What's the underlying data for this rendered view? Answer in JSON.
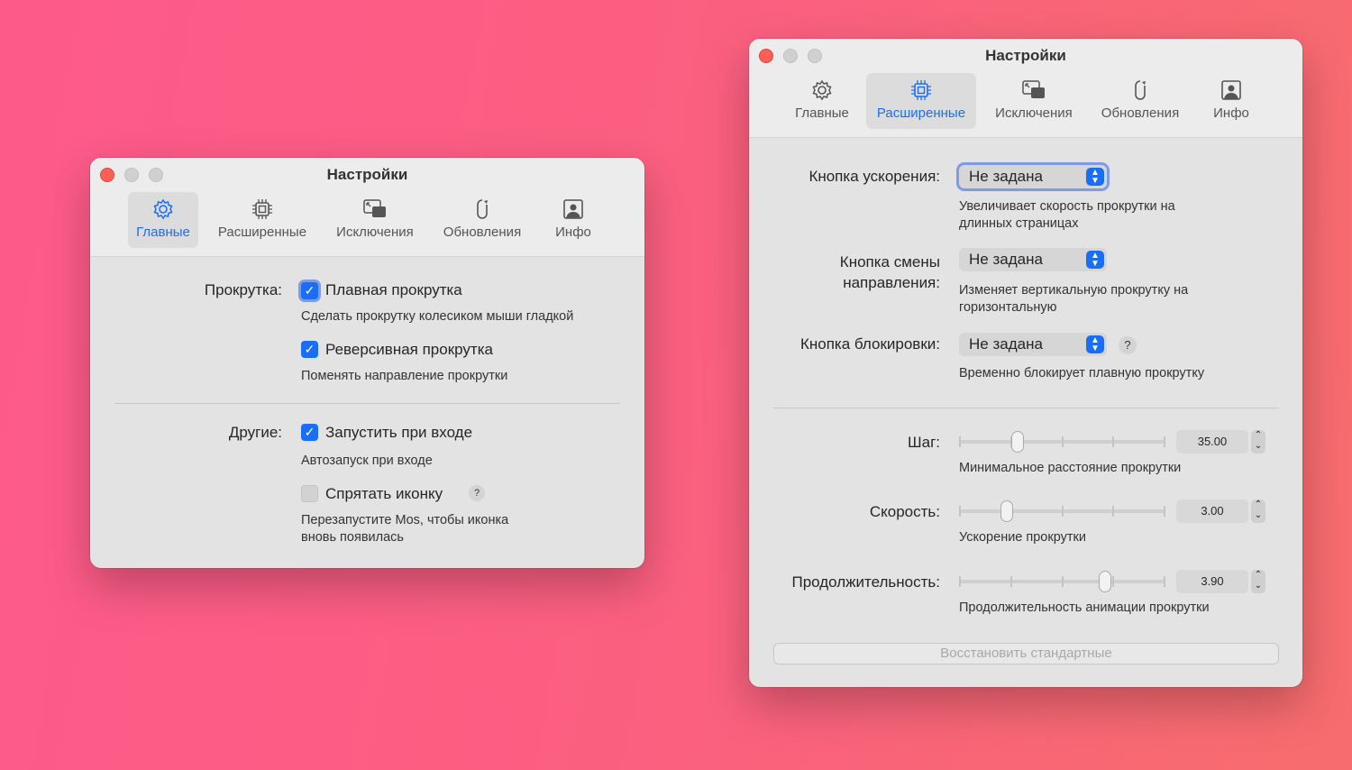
{
  "window1": {
    "title": "Настройки",
    "tabs": [
      {
        "label": "Главные",
        "icon": "gear-icon",
        "selected": true
      },
      {
        "label": "Расширенные",
        "icon": "chip-icon"
      },
      {
        "label": "Исключения",
        "icon": "exceptions-icon"
      },
      {
        "label": "Обновления",
        "icon": "update-icon"
      },
      {
        "label": "Инфо",
        "icon": "info-icon"
      }
    ],
    "scroll_label": "Прокрутка:",
    "smooth": {
      "label": "Плавная прокрутка",
      "checked": true,
      "desc": "Сделать прокрутку колесиком мыши гладкой"
    },
    "reverse": {
      "label": "Реверсивная прокрутка",
      "checked": true,
      "desc": "Поменять направление прокрутки"
    },
    "other_label": "Другие:",
    "launch": {
      "label": "Запустить при входе",
      "checked": true,
      "desc": "Автозапуск при входе"
    },
    "hide": {
      "label": "Спрятать иконку",
      "checked": false,
      "help": "?",
      "desc1": "Перезапустите Mos, чтобы иконка",
      "desc2": "вновь появилась"
    }
  },
  "window2": {
    "title": "Настройки",
    "tabs": [
      {
        "label": "Главные",
        "icon": "gear-icon"
      },
      {
        "label": "Расширенные",
        "icon": "chip-icon",
        "selected": true
      },
      {
        "label": "Исключения",
        "icon": "exceptions-icon"
      },
      {
        "label": "Обновления",
        "icon": "update-icon"
      },
      {
        "label": "Инфо",
        "icon": "info-icon"
      }
    ],
    "accel": {
      "label": "Кнопка ускорения:",
      "value": "Не задана",
      "desc1": "Увеличивает скорость прокрутки на",
      "desc2": "длинных страницах"
    },
    "dir": {
      "label1": "Кнопка смены",
      "label2": "направления:",
      "value": "Не задана",
      "desc1": "Изменяет вертикальную прокрутку на",
      "desc2": "горизонтальную"
    },
    "lock": {
      "label": "Кнопка блокировки:",
      "value": "Не задана",
      "help": "?",
      "desc": "Временно блокирует плавную прокрутку"
    },
    "step": {
      "label": "Шаг:",
      "value": "35.00",
      "fraction": 0.28,
      "desc": "Минимальное расстояние прокрутки"
    },
    "speed": {
      "label": "Скорость:",
      "value": "3.00",
      "fraction": 0.23,
      "desc": "Ускорение прокрутки"
    },
    "duration": {
      "label": "Продолжительность:",
      "value": "3.90",
      "fraction": 0.71,
      "desc": "Продолжительность анимации прокрутки"
    },
    "reset": "Восстановить стандартные"
  }
}
